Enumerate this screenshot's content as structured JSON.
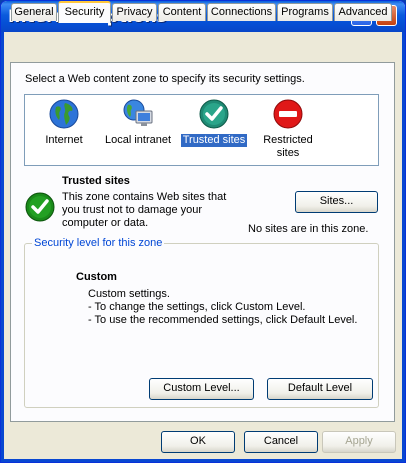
{
  "window": {
    "title": "Internet Options",
    "help_glyph": "?",
    "close_glyph": "✕"
  },
  "tabs": [
    {
      "label": "General"
    },
    {
      "label": "Security"
    },
    {
      "label": "Privacy"
    },
    {
      "label": "Content"
    },
    {
      "label": "Connections"
    },
    {
      "label": "Programs"
    },
    {
      "label": "Advanced"
    }
  ],
  "active_tab": "Security",
  "zone_prompt": "Select a Web content zone to specify its security settings.",
  "zones": [
    {
      "label": "Internet",
      "icon": "globe-icon"
    },
    {
      "label": "Local intranet",
      "icon": "intranet-globe-monitor-icon"
    },
    {
      "label": "Trusted sites",
      "icon": "checkmark-icon"
    },
    {
      "label": "Restricted sites",
      "icon": "no-entry-icon"
    }
  ],
  "selected_zone": "Trusted sites",
  "zone_info": {
    "title": "Trusted sites",
    "description": "This zone contains Web sites that you trust not to damage your computer or data.",
    "sites_button": "Sites...",
    "status": "No sites are in this zone."
  },
  "security_level": {
    "legend": "Security level for this zone",
    "title": "Custom",
    "lines": [
      "Custom settings.",
      "- To change the settings, click Custom Level.",
      "- To use the recommended settings, click Default Level."
    ],
    "custom_level_button": "Custom Level...",
    "default_level_button": "Default Level"
  },
  "dialog_buttons": {
    "ok": "OK",
    "cancel": "Cancel",
    "apply": "Apply"
  },
  "colors": {
    "title_bar": "#0b5bdd",
    "selection": "#316ac5",
    "legend_text": "#0046d5",
    "tab_highlight": "#ffc73c"
  }
}
